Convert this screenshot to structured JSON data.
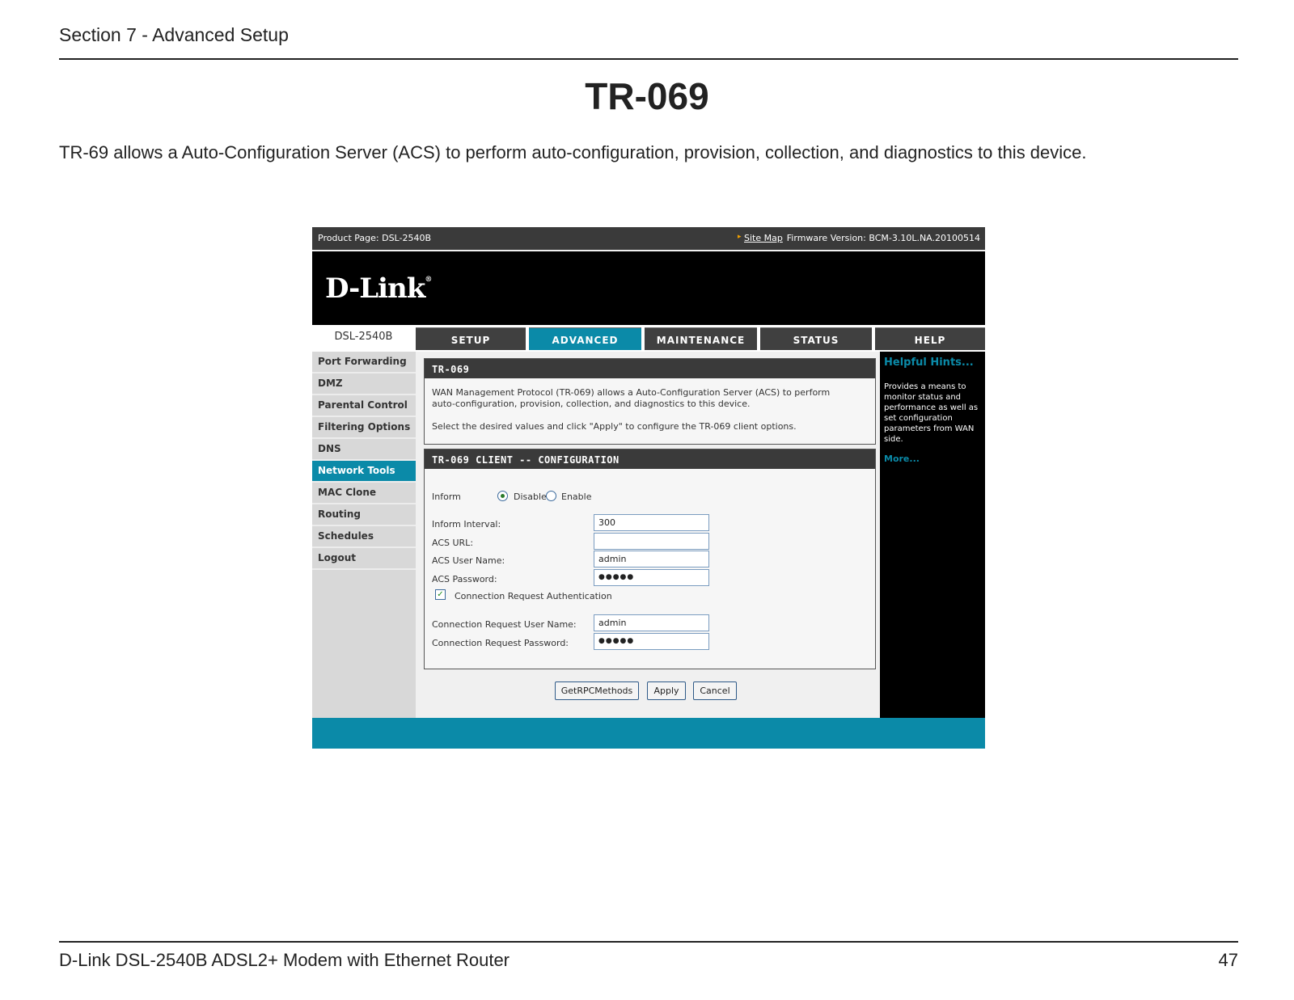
{
  "doc": {
    "section": "Section 7 - Advanced Setup",
    "title": "TR-069",
    "intro": "TR-69 allows a Auto-Configuration Server (ACS) to perform auto-configuration, provision, collection, and diagnostics to this device.",
    "footer_left": "D-Link DSL-2540B ADSL2+ Modem with Ethernet Router",
    "page_number": "47"
  },
  "ui": {
    "topbar": {
      "product": "Product Page: DSL-2540B",
      "site_map": "Site Map",
      "firmware": "Firmware Version: BCM-3.10L.NA.20100514"
    },
    "logo": "D-Link",
    "model": "DSL-2540B",
    "tabs": [
      "SETUP",
      "ADVANCED",
      "MAINTENANCE",
      "STATUS",
      "HELP"
    ],
    "sidebar": [
      "Port Forwarding",
      "DMZ",
      "Parental Control",
      "Filtering Options",
      "DNS",
      "Network Tools",
      "MAC Clone",
      "Routing",
      "Schedules",
      "Logout"
    ],
    "tr069": {
      "heading": "TR-069",
      "desc1": "WAN Management Protocol (TR-069) allows a Auto-Configuration Server (ACS) to perform",
      "desc2": "auto-configuration, provision, collection, and diagnostics to this device.",
      "desc3": "Select the desired values and click \"Apply\" to configure the TR-069 client options."
    },
    "config": {
      "heading": "TR-069 CLIENT -- CONFIGURATION",
      "inform_label": "Inform",
      "disable_label": "Disable",
      "enable_label": "Enable",
      "interval_label": "Inform Interval:",
      "interval_value": "300",
      "acs_url_label": "ACS URL:",
      "acs_url_value": "",
      "acs_user_label": "ACS User Name:",
      "acs_user_value": "admin",
      "acs_pass_label": "ACS Password:",
      "acs_pass_value": "●●●●●",
      "conn_auth_label": "Connection Request Authentication",
      "conn_user_label": "Connection Request User Name:",
      "conn_user_value": "admin",
      "conn_pass_label": "Connection Request Password:",
      "conn_pass_value": "●●●●●"
    },
    "buttons": {
      "getrpc": "GetRPCMethods",
      "apply": "Apply",
      "cancel": "Cancel"
    },
    "hints": {
      "title": "Helpful Hints...",
      "text": "Provides a means to monitor status and performance as well as set configuration parameters from WAN side.",
      "more": "More..."
    }
  }
}
